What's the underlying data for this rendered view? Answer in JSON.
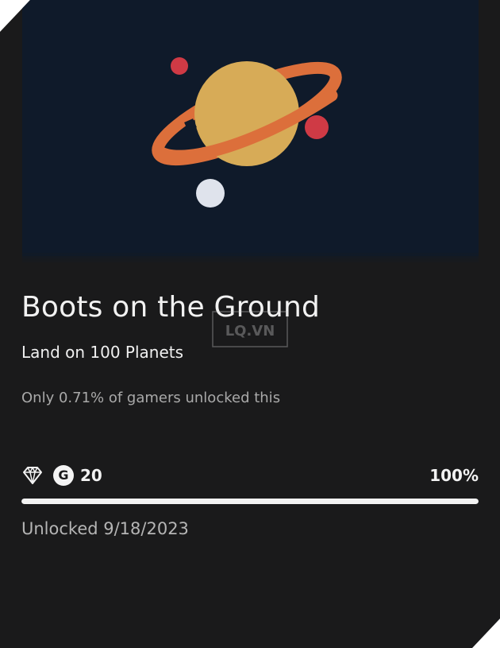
{
  "achievement": {
    "title": "Boots on the Ground",
    "subtitle": "Land on 100 Planets",
    "rarity_text": "Only 0.71% of gamers unlocked this",
    "gamerscore_icon": "G",
    "gamerscore": "20",
    "progress_label": "100%",
    "progress_value": 1.0,
    "unlocked_text": "Unlocked 9/18/2023"
  },
  "watermark": {
    "text": "LQ.VN"
  },
  "icons": {
    "rarity": "diamond-icon",
    "gamerscore": "gamerscore-icon",
    "art": "planet-icon"
  },
  "colors": {
    "card_background": "#1a1a1b",
    "art_background": "#0f1a2a",
    "planet": "#d7ab57",
    "ring": "#dc6f3b",
    "moon_red": "#cf3a45",
    "moon_white": "#dfe3ec",
    "progress_fill": "#f2f2f2"
  }
}
